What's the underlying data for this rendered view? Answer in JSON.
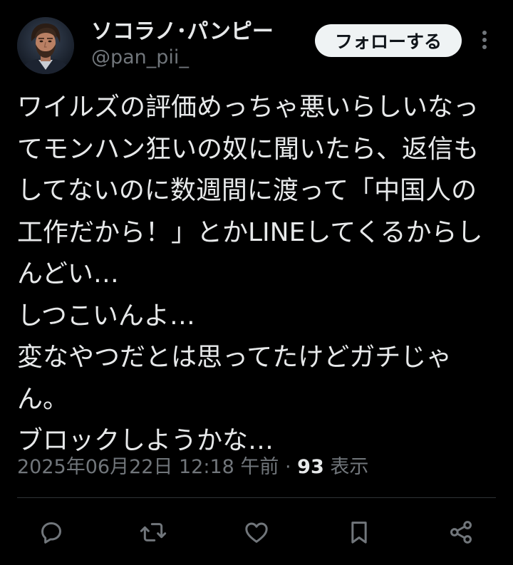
{
  "user": {
    "display_name": "ソコラノ･パンピー",
    "handle": "@pan_pii_",
    "avatar_icon": "man-portrait-avatar"
  },
  "follow_button": {
    "label": "フォローする"
  },
  "tweet": {
    "text": "ワイルズの評価めっちゃ悪いらしいなってモンハン狂いの奴に聞いたら、返信もしてないのに数週間に渡って「中国人の工作だから！」とかLINEしてくるからしんどい…\nしつこいんよ…\n変なやつだとは思ってたけどガチじゃん。\nブロックしようかな…"
  },
  "meta": {
    "timestamp": "2025年06月22日 12:18 午前",
    "separator": " · ",
    "views_count": "93",
    "views_label": " 表示"
  },
  "actions": {
    "reply_icon": "reply-icon",
    "retweet_icon": "retweet-icon",
    "like_icon": "heart-icon",
    "bookmark_icon": "bookmark-icon",
    "share_icon": "share-icon"
  },
  "colors": {
    "background": "#000000",
    "text_primary": "#e7e9ea",
    "text_secondary": "#71767b",
    "follow_button_bg": "#eff3f4",
    "divider": "#2f3336"
  }
}
